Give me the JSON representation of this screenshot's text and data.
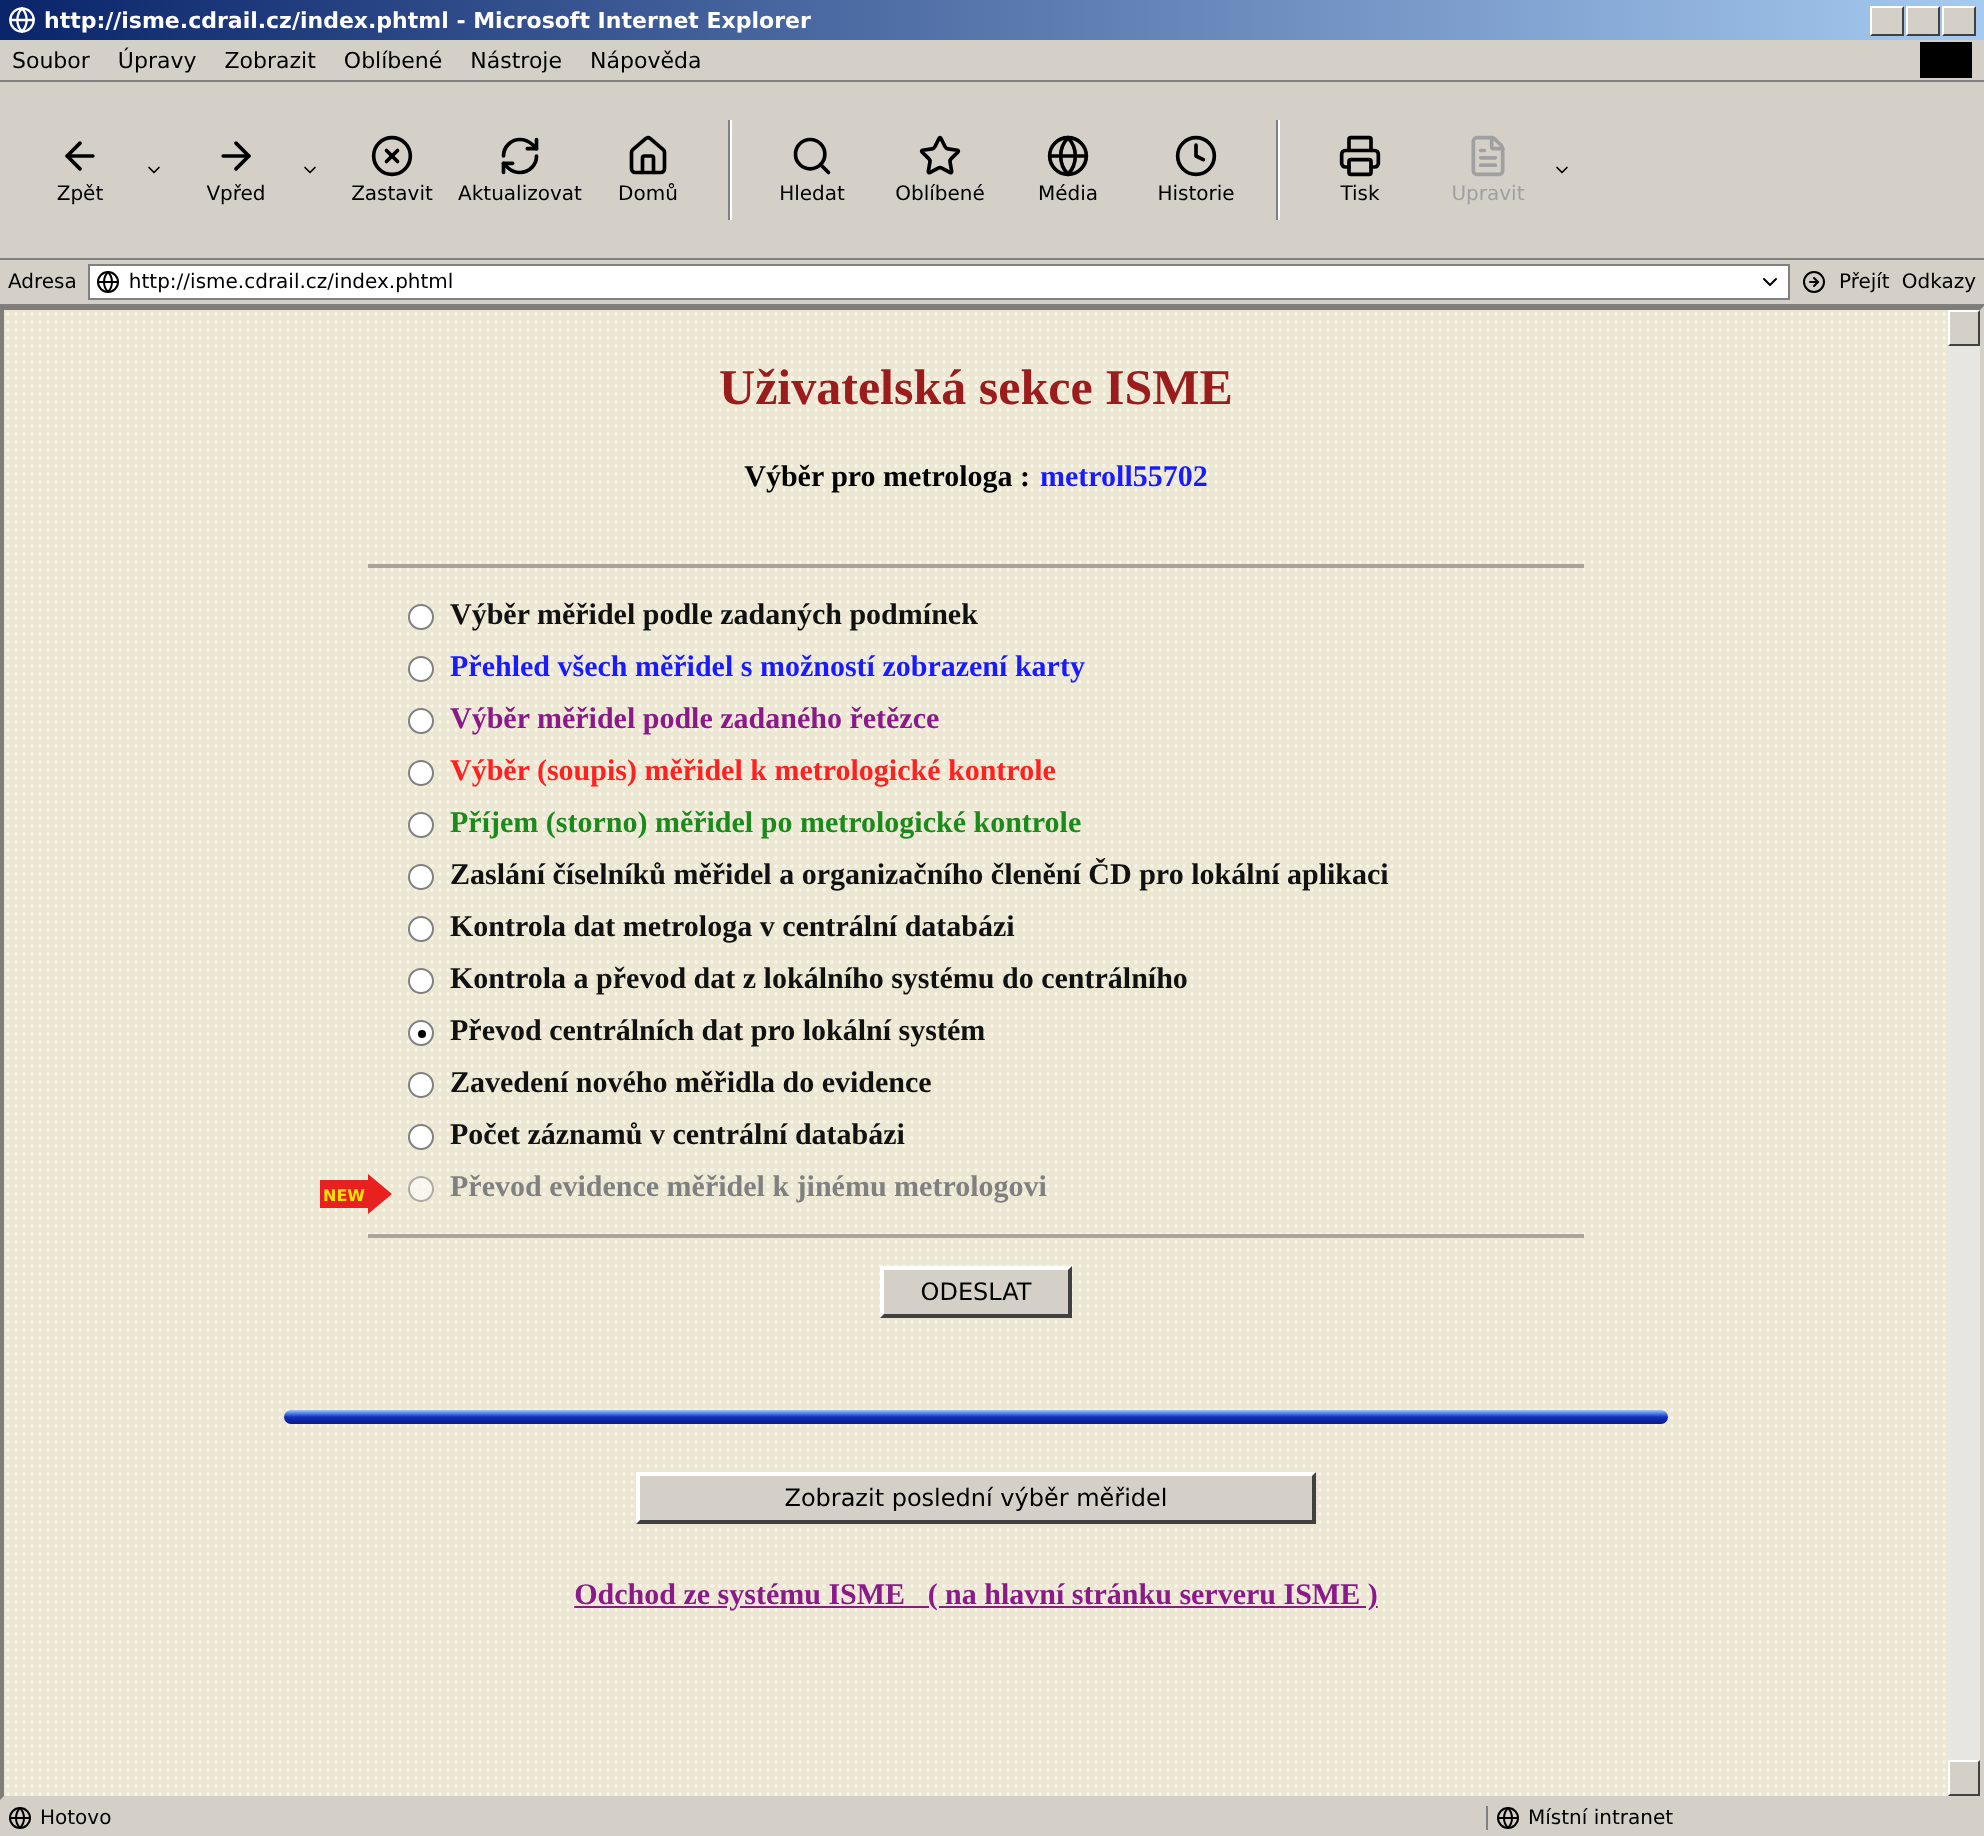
{
  "window": {
    "title": "http://isme.cdrail.cz/index.phtml - Microsoft Internet Explorer"
  },
  "menu": [
    {
      "label": "Soubor"
    },
    {
      "label": "Úpravy"
    },
    {
      "label": "Zobrazit"
    },
    {
      "label": "Oblíbené"
    },
    {
      "label": "Nástroje"
    },
    {
      "label": "Nápověda"
    }
  ],
  "toolbar": [
    {
      "label": "Zpět",
      "kind": "back",
      "dropdown": true,
      "disabled": false
    },
    {
      "label": "Vpřed",
      "kind": "forward",
      "dropdown": true,
      "disabled": false
    },
    {
      "label": "Zastavit",
      "kind": "stop",
      "dropdown": false,
      "disabled": false
    },
    {
      "label": "Aktualizovat",
      "kind": "refresh",
      "dropdown": false,
      "disabled": false
    },
    {
      "label": "Domů",
      "kind": "home",
      "dropdown": false,
      "disabled": false
    },
    {
      "label": "Hledat",
      "kind": "search",
      "dropdown": false,
      "disabled": false
    },
    {
      "label": "Oblíbené",
      "kind": "favorites",
      "dropdown": false,
      "disabled": false
    },
    {
      "label": "Média",
      "kind": "media",
      "dropdown": false,
      "disabled": false
    },
    {
      "label": "Historie",
      "kind": "history",
      "dropdown": false,
      "disabled": false
    },
    {
      "label": "Tisk",
      "kind": "print",
      "dropdown": false,
      "disabled": false
    },
    {
      "label": "Upravit",
      "kind": "edit",
      "dropdown": true,
      "disabled": true
    }
  ],
  "address": {
    "label": "Adresa",
    "value": "http://isme.cdrail.cz/index.phtml",
    "go": "Přejít",
    "links": "Odkazy"
  },
  "page": {
    "title": "Uživatelská sekce ISME",
    "subtitle": "Výběr pro metrologa :",
    "user": "metroll55702",
    "options": [
      {
        "label": "Výběr měřidel podle zadaných podmínek",
        "color": "#111111",
        "selected": false,
        "disabled": false,
        "new": false
      },
      {
        "label": "Přehled všech měřidel s možností zobrazení karty",
        "color": "#1a1aff",
        "selected": false,
        "disabled": false,
        "new": false
      },
      {
        "label": "Výběr měřidel podle zadaného řetězce",
        "color": "#8a1a8a",
        "selected": false,
        "disabled": false,
        "new": false
      },
      {
        "label": "Výběr (soupis) měřidel k metrologické kontrole",
        "color": "#ff2020",
        "selected": false,
        "disabled": false,
        "new": false
      },
      {
        "label": "Příjem (storno) měřidel po metrologické kontrole",
        "color": "#1a8a1a",
        "selected": false,
        "disabled": false,
        "new": false
      },
      {
        "label": "Zaslání číselníků měřidel a organizačního členění ČD pro lokální aplikaci",
        "color": "#111111",
        "selected": false,
        "disabled": false,
        "new": false
      },
      {
        "label": "Kontrola dat metrologa v centrální databázi",
        "color": "#111111",
        "selected": false,
        "disabled": false,
        "new": false
      },
      {
        "label": "Kontrola a převod dat z lokálního systému do centrálního",
        "color": "#111111",
        "selected": false,
        "disabled": false,
        "new": false
      },
      {
        "label": "Převod centrálních dat pro lokální systém",
        "color": "#111111",
        "selected": true,
        "disabled": false,
        "new": false
      },
      {
        "label": "Zavedení nového měřidla do evidence",
        "color": "#111111",
        "selected": false,
        "disabled": false,
        "new": false
      },
      {
        "label": "Počet záznamů v centrální databázi",
        "color": "#111111",
        "selected": false,
        "disabled": false,
        "new": false
      },
      {
        "label": "Převod evidence měřidel k jinému metrologovi",
        "color": "#808080",
        "selected": false,
        "disabled": true,
        "new": true,
        "badge": "NEW"
      }
    ],
    "submit": "ODESLAT",
    "last_selection": "Zobrazit poslední výběr měřidel",
    "logout": "Odchod ze systému ISME   ( na hlavní stránku serveru ISME )"
  },
  "status_bar": {
    "text": "Hotovo",
    "zone": "Místní intranet"
  }
}
